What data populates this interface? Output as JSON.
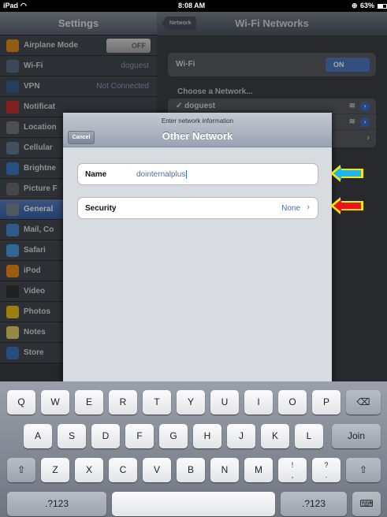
{
  "statusbar": {
    "device": "iPad",
    "time": "8:08 AM",
    "battery": "63%"
  },
  "settings": {
    "title": "Settings",
    "items": [
      {
        "label": "Airplane Mode",
        "value": "OFF",
        "icon": "airplane-icon",
        "color": "#e08a1e"
      },
      {
        "label": "Wi-Fi",
        "value": "doguest",
        "icon": "wifi-icon",
        "color": "#5b6f8c"
      },
      {
        "label": "VPN",
        "value": "Not Connected",
        "icon": "vpn-icon",
        "color": "#3d5f8f"
      },
      {
        "label": "Notificat",
        "value": "",
        "icon": "notifications-icon",
        "color": "#c83030"
      },
      {
        "label": "Location",
        "value": "",
        "icon": "location-icon",
        "color": "#777a80"
      },
      {
        "label": "Cellular",
        "value": "",
        "icon": "cellular-icon",
        "color": "#6a7a95"
      },
      {
        "label": "Brightne",
        "value": "",
        "icon": "brightness-icon",
        "color": "#3a7fc8"
      },
      {
        "label": "Picture F",
        "value": "",
        "icon": "picture-frame-icon",
        "color": "#6c6c6c"
      },
      {
        "label": "General",
        "value": "",
        "icon": "gear-icon",
        "color": "#7f8893"
      },
      {
        "label": "Mail, Co",
        "value": "",
        "icon": "mail-icon",
        "color": "#4a8ad6"
      },
      {
        "label": "Safari",
        "value": "",
        "icon": "safari-icon",
        "color": "#4aa0e0"
      },
      {
        "label": "iPod",
        "value": "",
        "icon": "ipod-icon",
        "color": "#f08a18"
      },
      {
        "label": "Video",
        "value": "",
        "icon": "video-icon",
        "color": "#333"
      },
      {
        "label": "Photos",
        "value": "",
        "icon": "photos-icon",
        "color": "#f2c419"
      },
      {
        "label": "Notes",
        "value": "",
        "icon": "notes-icon",
        "color": "#e9cf6b"
      },
      {
        "label": "Store",
        "value": "",
        "icon": "store-icon",
        "color": "#3b74c8"
      }
    ]
  },
  "wifi_panel": {
    "title": "Wi-Fi Networks",
    "back": "Network",
    "wifi_label": "Wi-Fi",
    "wifi_state": "ON",
    "choose": "Choose a Network...",
    "networks": [
      "✓ doguest",
      "",
      ""
    ]
  },
  "modal": {
    "prompt": "Enter network information",
    "title": "Other Network",
    "cancel": "Cancel",
    "name_label": "Name",
    "name_value": "dointernalplus",
    "security_label": "Security",
    "security_value": "None"
  },
  "keyboard": {
    "row1": [
      "Q",
      "W",
      "E",
      "R",
      "T",
      "Y",
      "U",
      "I",
      "O",
      "P"
    ],
    "row2": [
      "A",
      "S",
      "D",
      "F",
      "G",
      "H",
      "J",
      "K",
      "L"
    ],
    "join": "Join",
    "row3": [
      "Z",
      "X",
      "C",
      "V",
      "B",
      "N",
      "M"
    ],
    "excl_top": "!",
    "excl_bottom": ",",
    "q_top": "?",
    "q_bottom": ".",
    "num": ".?123"
  },
  "colors": {
    "arrow_blue": "#1fb6ef",
    "arrow_red": "#e8141a",
    "arrow_yellow": "#f3e60b"
  }
}
